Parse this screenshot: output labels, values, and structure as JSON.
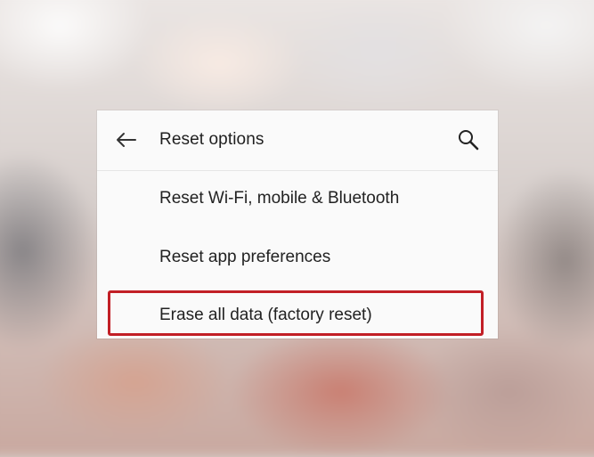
{
  "header": {
    "title": "Reset options",
    "back_icon": "arrow-left-icon",
    "search_icon": "search-icon"
  },
  "menu": {
    "items": [
      {
        "label": "Reset Wi-Fi, mobile & Bluetooth"
      },
      {
        "label": "Reset app preferences"
      },
      {
        "label": "Erase all data (factory reset)"
      }
    ]
  },
  "colors": {
    "highlight": "#c21f26",
    "panel_background": "#fafafa"
  }
}
